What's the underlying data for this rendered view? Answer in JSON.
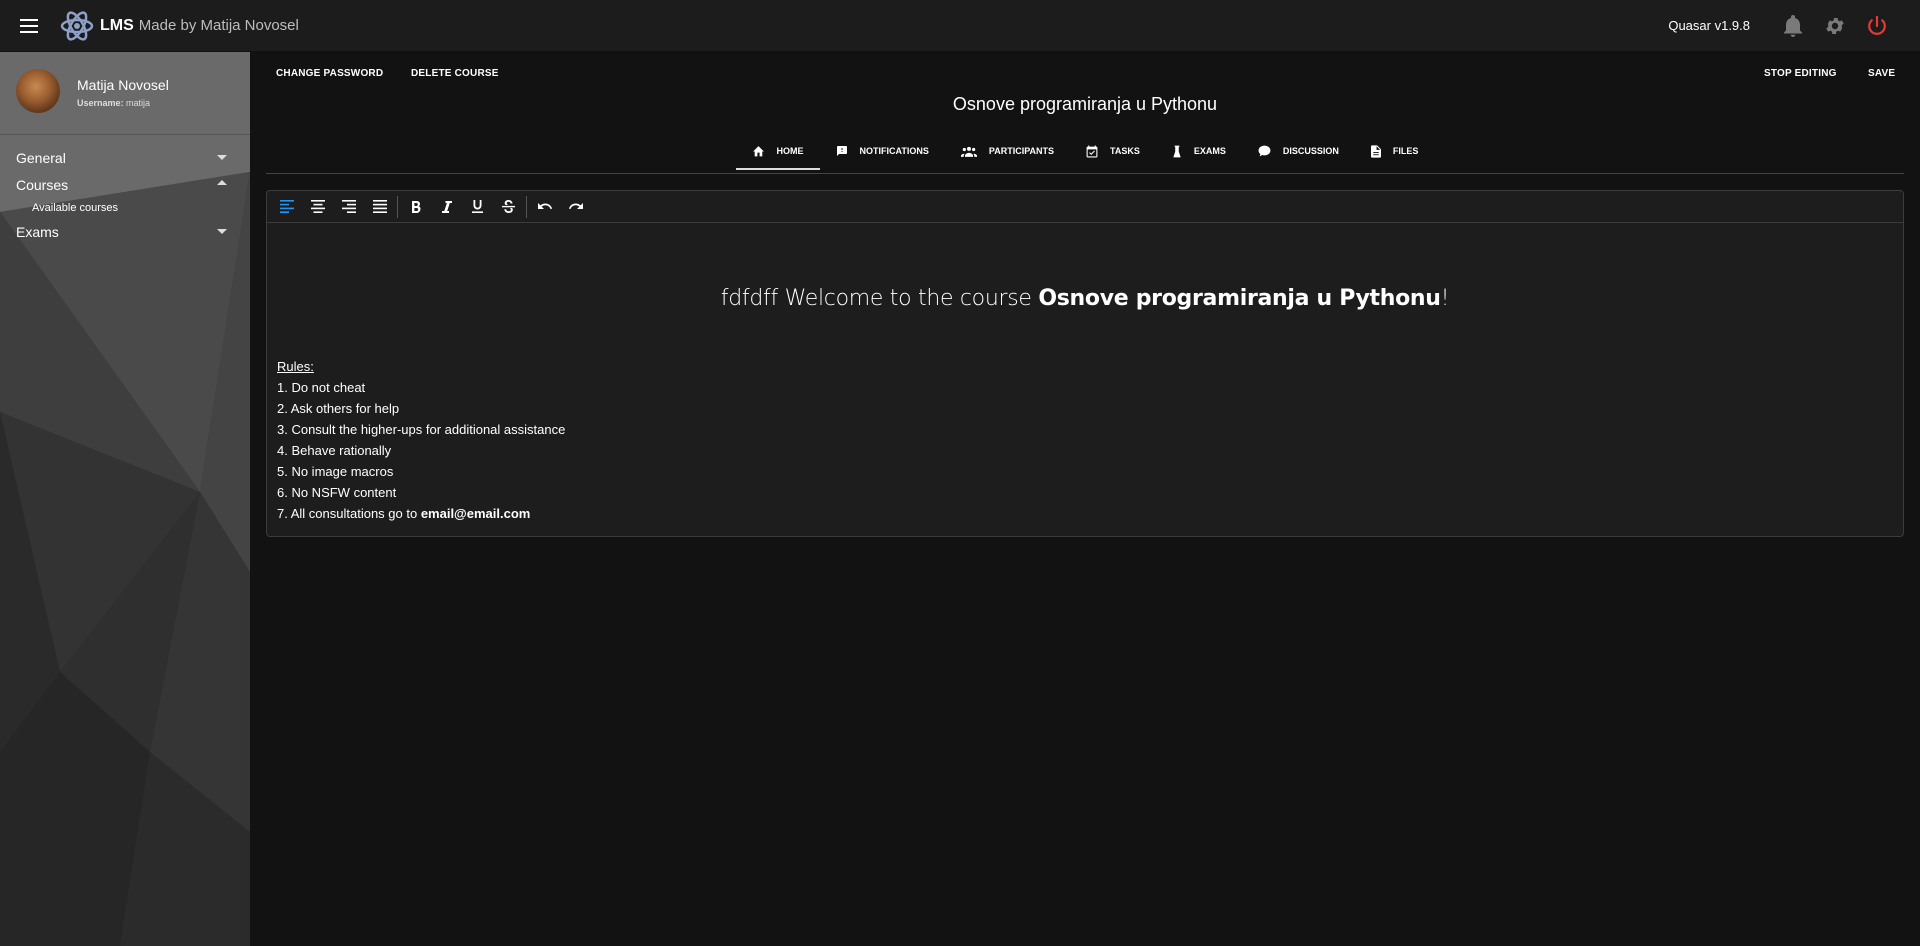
{
  "header": {
    "title": "LMS",
    "subtitle": "Made by Matija Novosel",
    "version": "Quasar v1.9.8"
  },
  "profile": {
    "name": "Matija Novosel",
    "username_label": "Username:",
    "username": "matija"
  },
  "nav": {
    "general": "General",
    "courses": "Courses",
    "available_courses": "Available courses",
    "exams": "Exams"
  },
  "actions": {
    "change_password": "CHANGE PASSWORD",
    "delete_course": "DELETE COURSE",
    "stop_editing": "STOP EDITING",
    "save": "SAVE"
  },
  "course": {
    "title": "Osnove programiranja u Pythonu"
  },
  "tabs": [
    {
      "label": "HOME",
      "icon": "home-icon"
    },
    {
      "label": "NOTIFICATIONS",
      "icon": "notification-icon"
    },
    {
      "label": "PARTICIPANTS",
      "icon": "people-icon"
    },
    {
      "label": "TASKS",
      "icon": "calendar-check-icon"
    },
    {
      "label": "EXAMS",
      "icon": "flask-icon"
    },
    {
      "label": "DISCUSSION",
      "icon": "chat-icon"
    },
    {
      "label": "FILES",
      "icon": "file-icon"
    }
  ],
  "editor": {
    "welcome_prefix": "fdfdff Welcome to the course ",
    "welcome_course": "Osnove programiranja u Pythonu",
    "welcome_suffix": "!",
    "rules_title": "Rules:",
    "rules": [
      "1. Do not cheat",
      "2. Ask others for help",
      "3. Consult the higher-ups for additional assistance",
      "4. Behave rationally",
      "5. No image macros",
      "6. No NSFW content"
    ],
    "rule7_prefix": "7. All consultations go to ",
    "rule7_email": "email@email.com"
  },
  "colors": {
    "accent_blue": "#2196f3",
    "power_red": "#e53935"
  }
}
